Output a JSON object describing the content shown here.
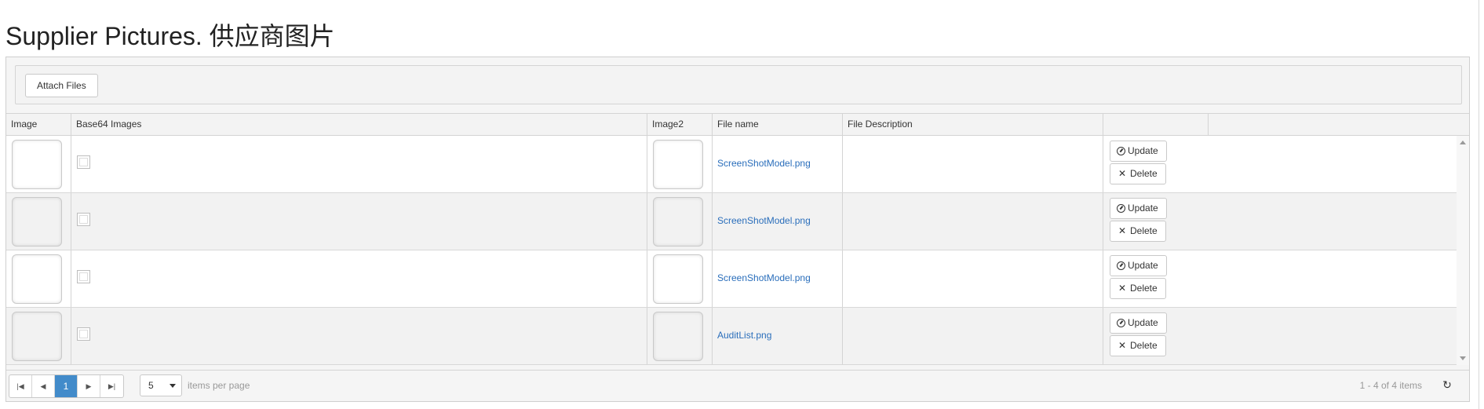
{
  "page": {
    "title": "Supplier Pictures. 供应商图片"
  },
  "toolbar": {
    "attach_label": "Attach Files"
  },
  "columns": [
    "Image",
    "Base64 Images",
    "Image2",
    "File name",
    "File Description",
    ""
  ],
  "rows": [
    {
      "file_name": "ScreenShotModel.png",
      "description": "",
      "update_label": "Update",
      "delete_label": "Delete"
    },
    {
      "file_name": "ScreenShotModel.png",
      "description": "",
      "update_label": "Update",
      "delete_label": "Delete"
    },
    {
      "file_name": "ScreenShotModel.png",
      "description": "",
      "update_label": "Update",
      "delete_label": "Delete"
    },
    {
      "file_name": "AuditList.png",
      "description": "",
      "update_label": "Update",
      "delete_label": "Delete"
    }
  ],
  "pager": {
    "first_icon": "first-page-icon",
    "prev_icon": "prev-page-icon",
    "current_page": "1",
    "next_icon": "next-page-icon",
    "last_icon": "last-page-icon",
    "page_size": "5",
    "items_per_page_label": "items per page",
    "info": "1 - 4 of 4 items",
    "refresh_icon": "refresh-icon"
  },
  "colors": {
    "link": "#2a6ebb",
    "active_page": "#428bca"
  }
}
